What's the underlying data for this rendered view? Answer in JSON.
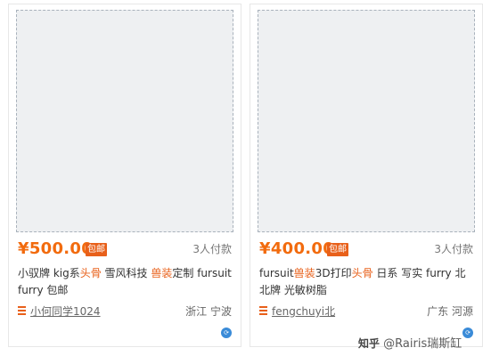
{
  "listings": [
    {
      "price": "¥500.00",
      "badge": "包邮",
      "sold": "3人付款",
      "title_parts": [
        "小驭牌 kig系",
        "头骨",
        " 雪风科技 ",
        "兽装",
        "定制 fursuit furry 包邮"
      ],
      "shop": "小何同学1024",
      "location": "浙江 宁波"
    },
    {
      "price": "¥400.00",
      "badge": "包邮",
      "sold": "3人付款",
      "title_parts": [
        "fursuit",
        "兽装",
        "3D打印",
        "头骨",
        " 日系 写实 furry 北北牌 光敏树脂"
      ],
      "shop": "fengchuyi北",
      "location": "广东 河源"
    }
  ],
  "watermark": {
    "brand": "知乎",
    "text": "@Rairis瑞斯缸"
  },
  "colors": {
    "price": "#f26b0e",
    "badge_bg": "#e8601a",
    "border": "#e7e7e7"
  }
}
